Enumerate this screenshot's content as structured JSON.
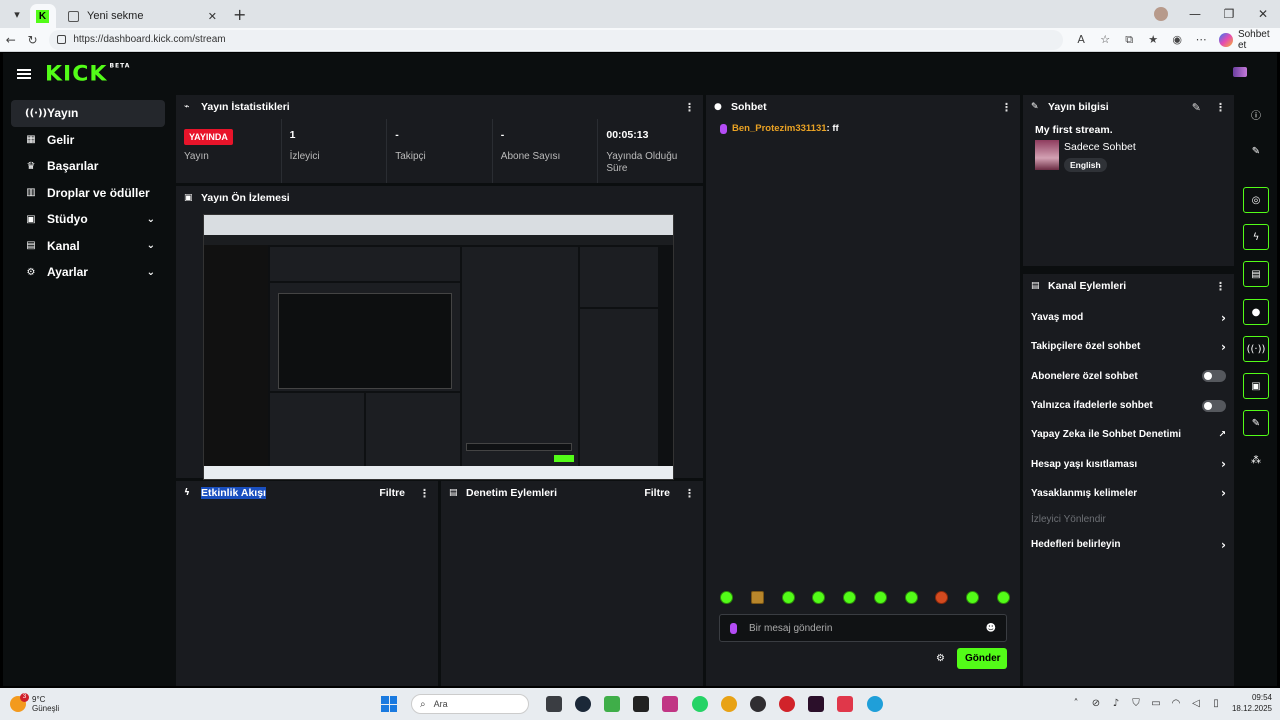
{
  "browser": {
    "tab_new_title": "Yeni sekme",
    "url": "https://dashboard.kick.com/stream",
    "copilot_label": "Sohbet et"
  },
  "app": {
    "logo_text": "KICK",
    "logo_badge": "BETA",
    "brand_color": "#53fc18"
  },
  "sidebar": {
    "items": [
      {
        "label": "Yayın",
        "icon": "broadcast-icon"
      },
      {
        "label": "Gelir",
        "icon": "revenue-icon"
      },
      {
        "label": "Başarılar",
        "icon": "trophy-icon"
      },
      {
        "label": "Droplar ve ödüller",
        "icon": "drops-icon"
      },
      {
        "label": "Stüdyo",
        "icon": "studio-icon"
      },
      {
        "label": "Kanal",
        "icon": "channel-icon"
      },
      {
        "label": "Ayarlar",
        "icon": "gear-icon"
      }
    ]
  },
  "stats_panel": {
    "title": "Yayın İstatistikleri",
    "live_badge": "YAYINDA",
    "items": [
      {
        "value": "",
        "label": "Yayın"
      },
      {
        "value": "1",
        "label": "İzleyici"
      },
      {
        "value": "-",
        "label": "Takipçi"
      },
      {
        "value": "-",
        "label": "Abone Sayısı"
      },
      {
        "value": "00:05:13",
        "label": "Yayında Olduğu Süre"
      }
    ]
  },
  "preview_panel": {
    "title": "Yayın Ön İzlemesi"
  },
  "activity_panel": {
    "title": "Etkinlik Akışı",
    "filter": "Filtre"
  },
  "moderation_panel": {
    "title": "Denetim Eylemleri",
    "filter": "Filtre"
  },
  "chat_panel": {
    "title": "Sohbet",
    "messages": [
      {
        "user": "Ben_Protezim331131",
        "text": ": ff"
      }
    ],
    "input_placeholder": "Bir mesaj gönderin",
    "send_label": "Gönder"
  },
  "stream_info": {
    "title": "Yayın bilgisi",
    "stream_title": "My first stream.",
    "category": "Sadece Sohbet",
    "language": "English"
  },
  "channel_actions": {
    "title": "Kanal Eylemleri",
    "items": [
      {
        "label": "Yavaş mod",
        "control": "chevron"
      },
      {
        "label": "Takipçilere özel sohbet",
        "control": "chevron"
      },
      {
        "label": "Abonelere özel sohbet",
        "control": "toggle"
      },
      {
        "label": "Yalnızca ifadelerle sohbet",
        "control": "toggle"
      },
      {
        "label": "Yapay Zeka ile Sohbet Denetimi",
        "control": "external"
      },
      {
        "label": "Hesap yaşı kısıtlaması",
        "control": "chevron"
      },
      {
        "label": "Yasaklanmış kelimeler",
        "control": "chevron"
      },
      {
        "label": "İzleyici Yönlendir",
        "control": "none"
      },
      {
        "label": "Hedefleri belirleyin",
        "control": "chevron"
      }
    ]
  },
  "taskbar": {
    "weather_temp": "9°C",
    "weather_desc": "Güneşli",
    "weather_badge": "3",
    "search_placeholder": "Ara",
    "time": "09:54",
    "date": "18.12.2025"
  }
}
